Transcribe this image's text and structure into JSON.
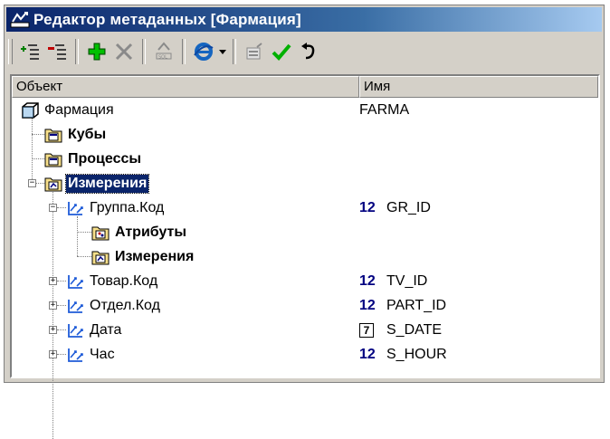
{
  "window": {
    "title": "Редактор метаданных [Фармация]"
  },
  "toolbar": {
    "buttons": [
      {
        "icon": "add-node-icon"
      },
      {
        "icon": "remove-node-icon"
      },
      {
        "icon": "add-icon"
      },
      {
        "icon": "delete-icon"
      },
      {
        "icon": "sql-icon"
      },
      {
        "icon": "browser-icon"
      },
      {
        "icon": "properties-icon"
      },
      {
        "icon": "check-icon"
      },
      {
        "icon": "undo-icon"
      }
    ]
  },
  "columns": {
    "object": "Объект",
    "name": "Имя"
  },
  "tree": {
    "root": {
      "label": "Фармация",
      "value": "FARMA"
    },
    "cubes": {
      "label": "Кубы"
    },
    "processes": {
      "label": "Процессы"
    },
    "dimensions": {
      "label": "Измерения"
    },
    "group": {
      "label": "Группа.Код",
      "type": "12",
      "value": "GR_ID"
    },
    "attributes": {
      "label": "Атрибуты"
    },
    "group_dimensions": {
      "label": "Измерения"
    },
    "product": {
      "label": "Товар.Код",
      "type": "12",
      "value": "TV_ID"
    },
    "department": {
      "label": "Отдел.Код",
      "type": "12",
      "value": "PART_ID"
    },
    "date": {
      "label": "Дата",
      "type": "7",
      "value": "S_DATE"
    },
    "hour": {
      "label": "Час",
      "type": "12",
      "value": "S_HOUR"
    }
  },
  "colors": {
    "selection": "#0a246a",
    "type_badge": "#000080",
    "window_bg": "#d4d0c8"
  }
}
